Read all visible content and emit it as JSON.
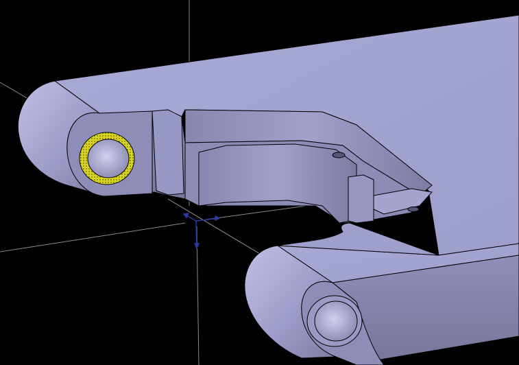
{
  "viewport": {
    "background": "#000000",
    "part_color": "#a3a3cf",
    "part_shadow_color": "#7d7da6",
    "highlight_color": "#d7d31f",
    "axes": {
      "x_label": "",
      "y_label": "",
      "z_label": ""
    }
  }
}
